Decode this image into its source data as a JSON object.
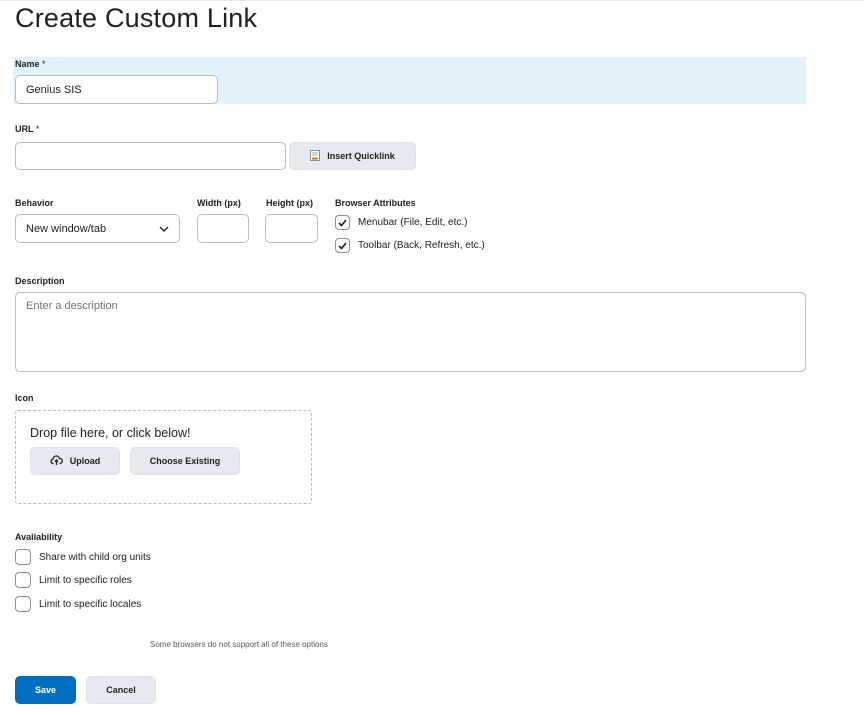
{
  "page": {
    "title": "Create Custom Link"
  },
  "name_field": {
    "label": "Name",
    "required_mark": "*",
    "value": "Genius SIS"
  },
  "url_field": {
    "label": "URL",
    "required_mark": "*",
    "value": "",
    "quicklink_button": "Insert Quicklink"
  },
  "behavior": {
    "label": "Behavior",
    "selected": "New window/tab"
  },
  "width": {
    "label": "Width (px)",
    "value": ""
  },
  "height": {
    "label": "Height (px)",
    "value": ""
  },
  "browser_attributes": {
    "label": "Browser Attributes",
    "options": [
      {
        "label": "Menubar (File, Edit, etc.)",
        "checked": true
      },
      {
        "label": "Toolbar (Back, Refresh, etc.)",
        "checked": true
      }
    ]
  },
  "description": {
    "label": "Description",
    "placeholder": "Enter a description"
  },
  "icon": {
    "label": "Icon",
    "drop_text": "Drop file here, or click below!",
    "upload_button": "Upload",
    "choose_button": "Choose Existing"
  },
  "availability": {
    "label": "Availability",
    "options": [
      {
        "label": "Share with child org units",
        "checked": false
      },
      {
        "label": "Limit to specific roles",
        "checked": false
      },
      {
        "label": "Limit to specific locales",
        "checked": false
      }
    ]
  },
  "hint": "Some browsers do not support all of these options",
  "actions": {
    "save": "Save",
    "cancel": "Cancel"
  },
  "colors": {
    "primary": "#006fbf",
    "name_highlight": "#e3f3fe",
    "button_bg": "#e6eaf0"
  }
}
